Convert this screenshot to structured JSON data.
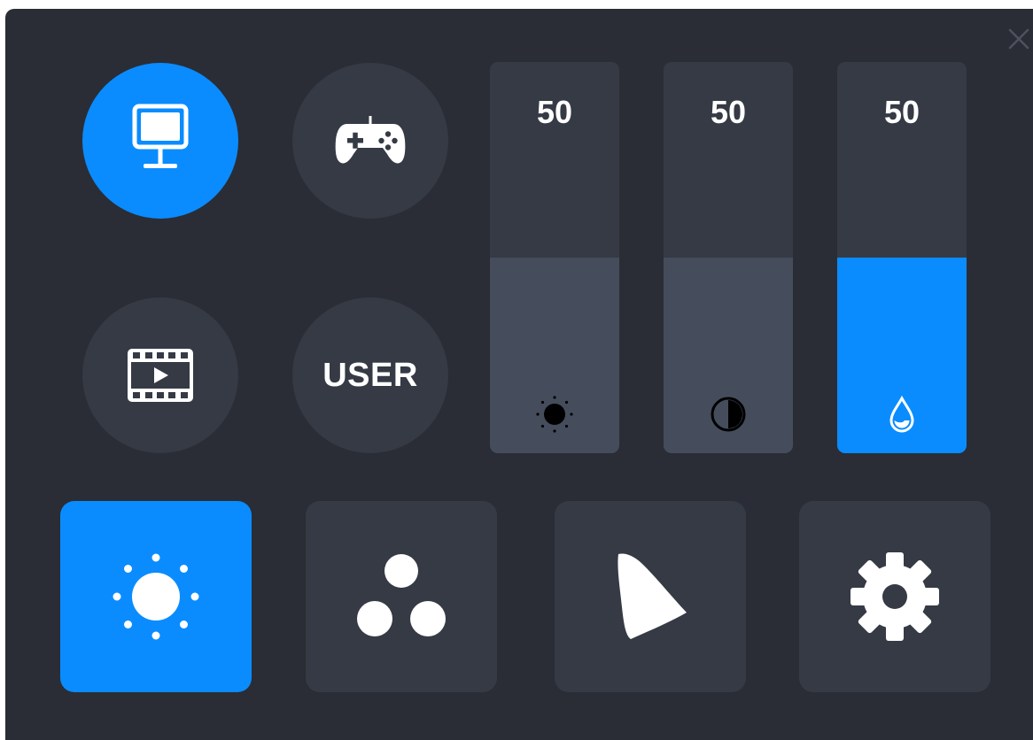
{
  "window": {
    "close_icon": "close-icon"
  },
  "modes": [
    {
      "name": "standard",
      "icon": "monitor-icon",
      "active": true
    },
    {
      "name": "game",
      "icon": "gamepad-icon",
      "active": false
    },
    {
      "name": "movie",
      "icon": "film-icon",
      "active": false
    },
    {
      "name": "user",
      "label": "USER",
      "active": false
    }
  ],
  "sliders": [
    {
      "name": "brightness",
      "value": "50",
      "level": 0.5,
      "icon": "brightness-icon"
    },
    {
      "name": "contrast",
      "value": "50",
      "level": 0.5,
      "icon": "contrast-icon"
    },
    {
      "name": "saturation",
      "value": "50",
      "level": 0.5,
      "icon": "water-drop-icon"
    }
  ],
  "tabs": [
    {
      "name": "brightness",
      "icon": "sun-icon",
      "active": true
    },
    {
      "name": "color",
      "icon": "three-circles-icon",
      "active": false
    },
    {
      "name": "gamut",
      "icon": "color-gamut-icon",
      "active": false
    },
    {
      "name": "settings",
      "icon": "gear-icon",
      "active": false
    }
  ],
  "colors": {
    "accent": "#0a8cff",
    "panel_background": "#2a2d35",
    "control_background": "#353a45",
    "slider_fill": "#454d5c"
  }
}
